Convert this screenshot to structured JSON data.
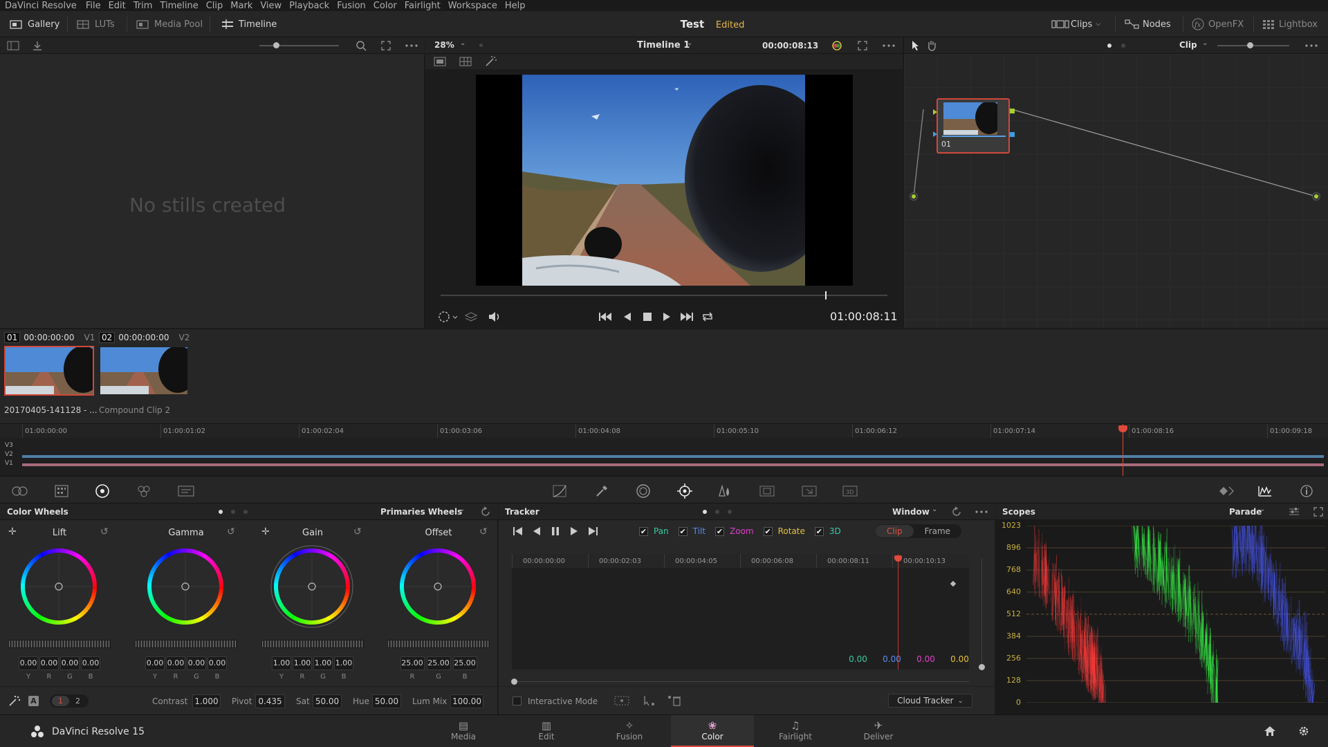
{
  "menubar": {
    "items": [
      "DaVinci Resolve",
      "File",
      "Edit",
      "Trim",
      "Timeline",
      "Clip",
      "Mark",
      "View",
      "Playback",
      "Fusion",
      "Color",
      "Fairlight",
      "Workspace",
      "Help"
    ]
  },
  "toolbar": {
    "gallery": "Gallery",
    "luts": "LUTs",
    "media_pool": "Media Pool",
    "timeline": "Timeline",
    "project_title": "Test",
    "project_status": "Edited",
    "clips": "Clips",
    "nodes": "Nodes",
    "openfx": "OpenFX",
    "lightbox": "Lightbox"
  },
  "viewer": {
    "zoom": "28%",
    "timeline_name": "Timeline 1",
    "timecode_top": "00:00:08:13",
    "timecode": "01:00:08:11",
    "scrub_position": 0.86
  },
  "gallery": {
    "empty_text": "No stills created"
  },
  "node_editor": {
    "mode": "Clip",
    "node_label": "01"
  },
  "clips": [
    {
      "num": "01",
      "tc": "00:00:00:00",
      "track": "V1",
      "name": "20170405-141128 - ...",
      "selected": true
    },
    {
      "num": "02",
      "tc": "00:00:00:00",
      "track": "V2",
      "name": "Compound Clip 2",
      "selected": false
    }
  ],
  "mini_timeline": {
    "ticks": [
      "01:00:00:00",
      "01:00:01:02",
      "01:00:02:04",
      "01:00:03:06",
      "01:00:04:08",
      "01:00:05:10",
      "01:00:06:12",
      "01:00:07:14",
      "01:00:08:16",
      "01:00:09:18"
    ],
    "tracks": [
      "V3",
      "V2",
      "V1"
    ]
  },
  "color_wheels": {
    "title": "Color Wheels",
    "mode": "Primaries Wheels",
    "wheels": [
      {
        "name": "Lift",
        "values": [
          "0.00",
          "0.00",
          "0.00",
          "0.00"
        ],
        "labels": [
          "Y",
          "R",
          "G",
          "B"
        ]
      },
      {
        "name": "Gamma",
        "values": [
          "0.00",
          "0.00",
          "0.00",
          "0.00"
        ],
        "labels": [
          "Y",
          "R",
          "G",
          "B"
        ]
      },
      {
        "name": "Gain",
        "values": [
          "1.00",
          "1.00",
          "1.00",
          "1.00"
        ],
        "labels": [
          "Y",
          "R",
          "G",
          "B"
        ]
      },
      {
        "name": "Offset",
        "values": [
          "25.00",
          "25.00",
          "25.00"
        ],
        "labels": [
          "R",
          "G",
          "B"
        ]
      }
    ],
    "page1": "1",
    "page2": "2",
    "contrast_label": "Contrast",
    "contrast": "1.000",
    "pivot_label": "Pivot",
    "pivot": "0.435",
    "sat_label": "Sat",
    "sat": "50.00",
    "hue_label": "Hue",
    "hue": "50.00",
    "lummix_label": "Lum Mix",
    "lummix": "100.00"
  },
  "tracker": {
    "title": "Tracker",
    "mode": "Window",
    "checks": [
      {
        "label": "Pan",
        "color": "#3cc8a0"
      },
      {
        "label": "Tilt",
        "color": "#5a8cf0"
      },
      {
        "label": "Zoom",
        "color": "#e040c8"
      },
      {
        "label": "Rotate",
        "color": "#e6c040"
      },
      {
        "label": "3D",
        "color": "#3cc8a0"
      }
    ],
    "clip_btn": "Clip",
    "frame_btn": "Frame",
    "ticks": [
      "00:00:00:00",
      "00:00:02:03",
      "00:00:04:05",
      "00:00:06:08",
      "00:00:08:11",
      "00:00:10:13"
    ],
    "values": [
      {
        "v": "0.00",
        "color": "#3cc8a0"
      },
      {
        "v": "0.00",
        "color": "#5a8cf0"
      },
      {
        "v": "0.00",
        "color": "#e040c8"
      },
      {
        "v": "0.00",
        "color": "#e6c040"
      }
    ],
    "interactive_mode": "Interactive Mode",
    "cloud_tracker": "Cloud Tracker"
  },
  "scopes": {
    "title": "Scopes",
    "mode": "Parade",
    "scale": [
      "1023",
      "896",
      "768",
      "640",
      "512",
      "384",
      "256",
      "128",
      "0"
    ]
  },
  "bottom_nav": {
    "app_name": "DaVinci Resolve 15",
    "pages": [
      {
        "label": "Media",
        "active": false
      },
      {
        "label": "Edit",
        "active": false
      },
      {
        "label": "Fusion",
        "active": false
      },
      {
        "label": "Color",
        "active": true
      },
      {
        "label": "Fairlight",
        "active": false
      },
      {
        "label": "Deliver",
        "active": false
      }
    ]
  }
}
